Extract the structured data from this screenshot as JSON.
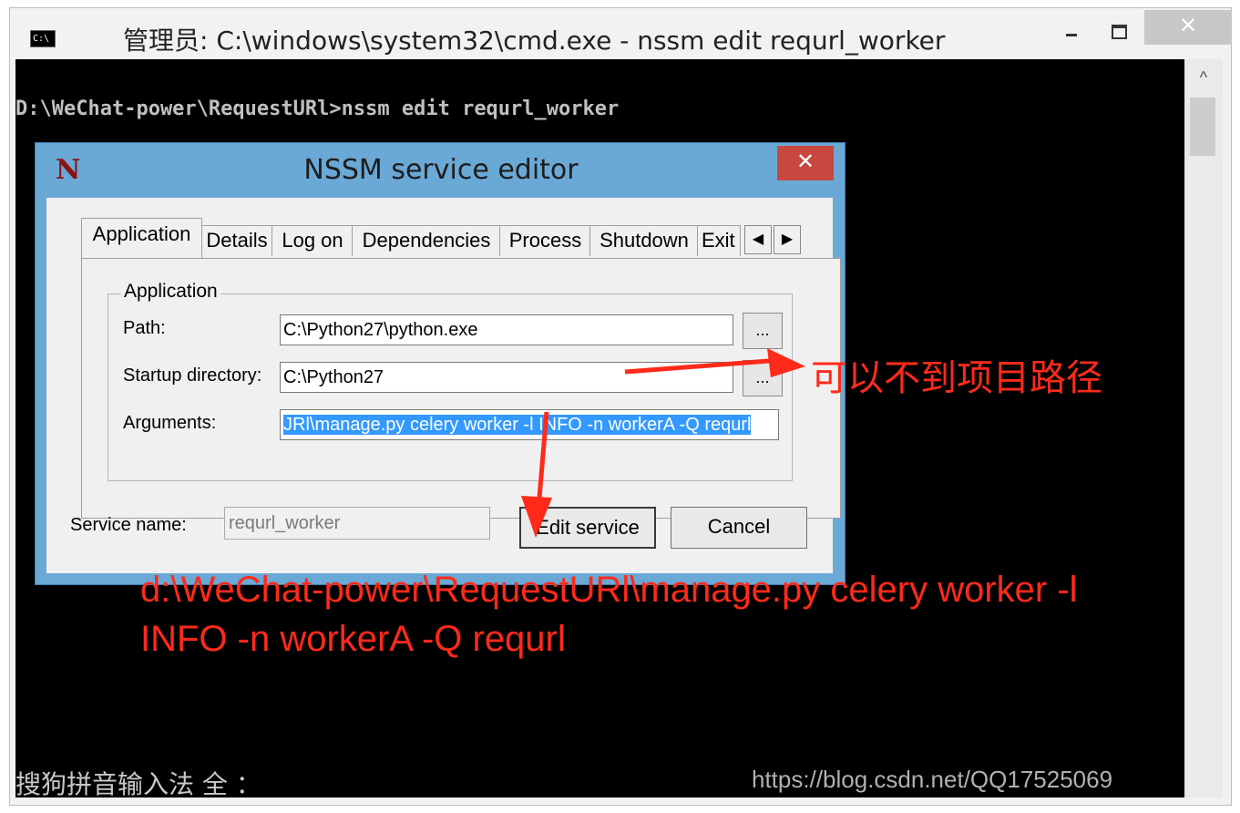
{
  "console_window": {
    "icon_label": "C:\\",
    "title": "管理员: C:\\windows\\system32\\cmd.exe - nssm  edit requrl_worker",
    "minimize_icon": "minimize-icon",
    "maximize_icon": "maximize-icon",
    "close_glyph": "✕",
    "prompt_line": "D:\\WeChat-power\\RequestURl>nssm edit requrl_worker",
    "ime_status": "搜狗拼音输入法 全 ：",
    "watermark": "https://blog.csdn.net/QQ17525069",
    "scroll_up_glyph": "^"
  },
  "nssm_dialog": {
    "icon_letter": "N",
    "title": "NSSM service editor",
    "close_glyph": "✕",
    "tabs": [
      {
        "label": "Application",
        "active": true
      },
      {
        "label": "Details"
      },
      {
        "label": "Log on"
      },
      {
        "label": "Dependencies"
      },
      {
        "label": "Process"
      },
      {
        "label": "Shutdown"
      },
      {
        "label": "Exit"
      }
    ],
    "tab_scroll_left": "◀",
    "tab_scroll_right": "▶",
    "group_label": "Application",
    "fields": {
      "path": {
        "label": "Path:",
        "value": "C:\\Python27\\python.exe"
      },
      "startup_directory": {
        "label": "Startup directory:",
        "value": "C:\\Python27"
      },
      "arguments": {
        "label": "Arguments:",
        "value": "JRl\\manage.py celery worker -l INFO -n workerA -Q requrl"
      }
    },
    "browse_label": "...",
    "service_name": {
      "label": "Service name:",
      "value": "requrl_worker"
    },
    "buttons": {
      "edit_service": "Edit service",
      "cancel": "Cancel"
    }
  },
  "annotations": {
    "startup_note": "可以不到项目路径",
    "arguments_note": "d:\\WeChat-power\\RequestURl\\manage.py celery worker -l\nINFO -n workerA -Q requrl",
    "color": "#ff2a1a"
  }
}
